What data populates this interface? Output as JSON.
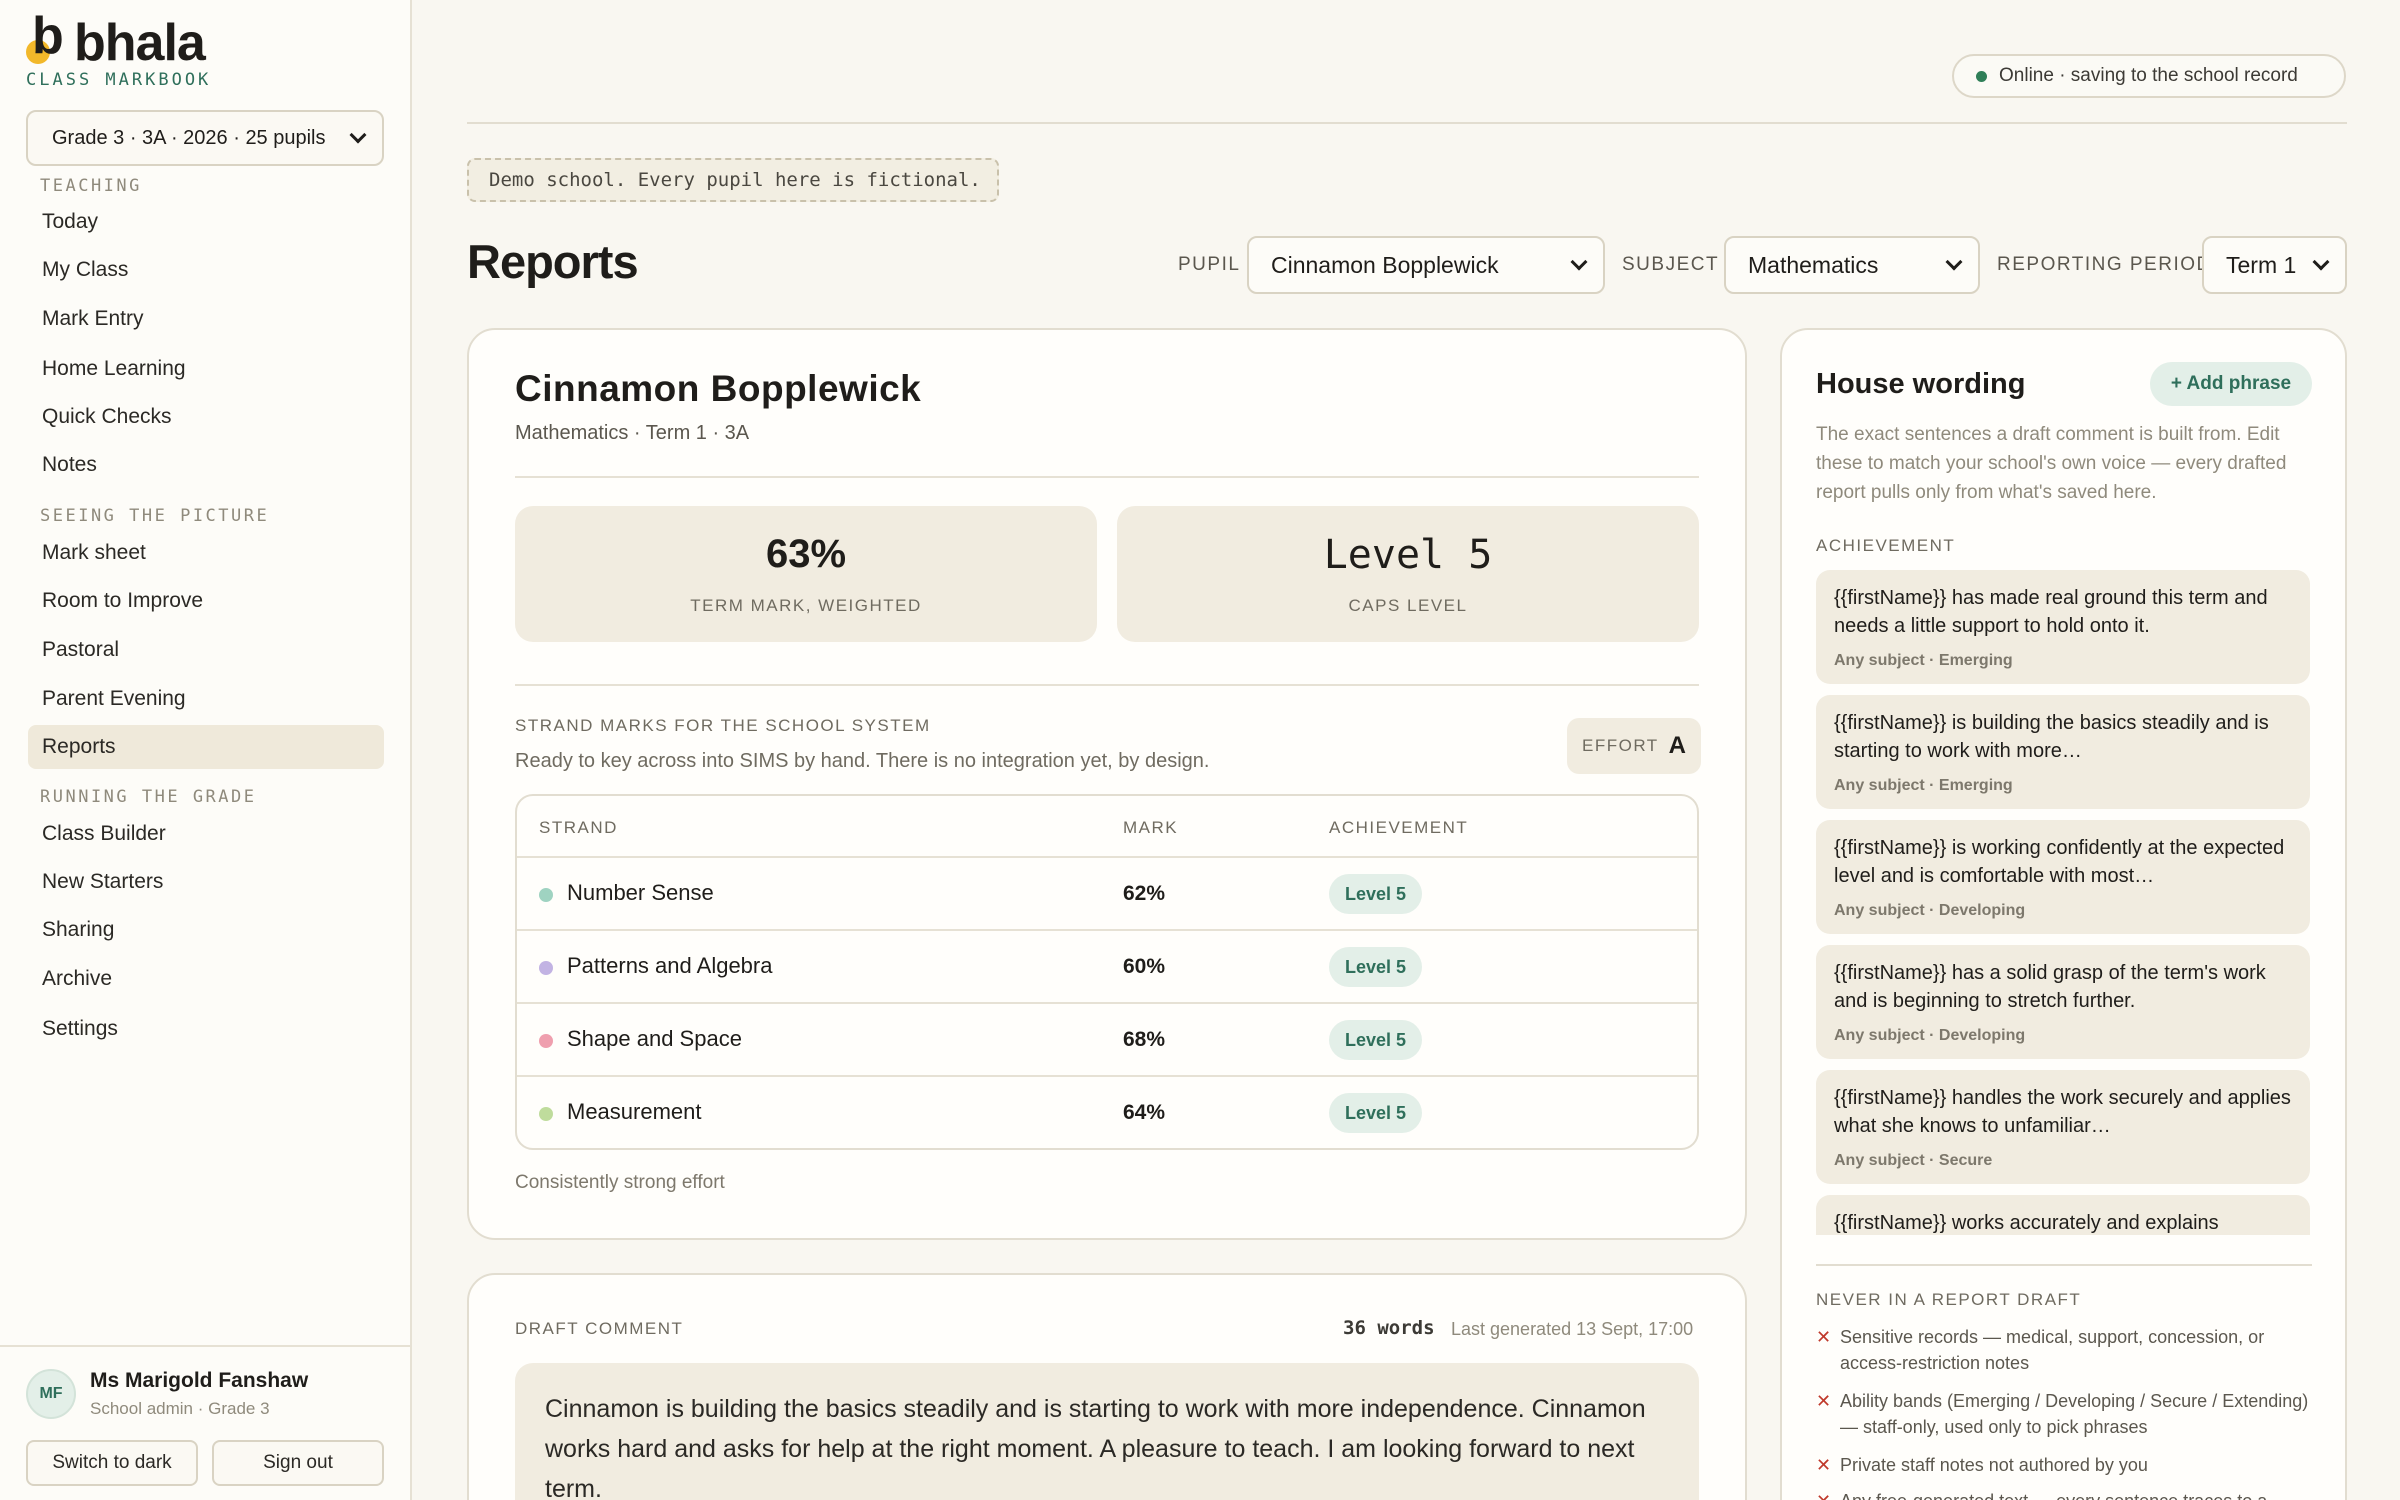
{
  "brand": {
    "logo_letter": "b",
    "name": "bhala",
    "subtitle": "CLASS MARKBOOK"
  },
  "class_selector": {
    "value": "Grade 3 · 3A · 2026 · 25 pupils"
  },
  "nav": {
    "groups": [
      {
        "title": "TEACHING",
        "items": [
          "Today",
          "My Class",
          "Mark Entry",
          "Home Learning",
          "Quick Checks",
          "Notes"
        ]
      },
      {
        "title": "SEEING THE PICTURE",
        "items": [
          "Mark sheet",
          "Room to Improve",
          "Pastoral",
          "Parent Evening",
          "Reports"
        ]
      },
      {
        "title": "RUNNING THE GRADE",
        "items": [
          "Class Builder",
          "New Starters",
          "Sharing",
          "Archive",
          "Settings"
        ]
      }
    ],
    "active": "Reports"
  },
  "user": {
    "initials": "MF",
    "name": "Ms Marigold Fanshaw",
    "role": "School admin · Grade 3",
    "switch_theme": "Switch to dark",
    "sign_out": "Sign out"
  },
  "status": {
    "text": "Online · saving to the school record",
    "color": "#2f7f58"
  },
  "demo_notice": "Demo school. Every pupil here is fictional.",
  "page": {
    "title": "Reports"
  },
  "filters": {
    "pupil": {
      "label": "PUPIL",
      "value": "Cinnamon Bopplewick"
    },
    "subject": {
      "label": "SUBJECT",
      "value": "Mathematics"
    },
    "period": {
      "label": "REPORTING PERIOD",
      "value": "Term 1"
    }
  },
  "report": {
    "pupil_name": "Cinnamon Bopplewick",
    "meta": "Mathematics · Term 1 · 3A",
    "term_mark": {
      "value": "63%",
      "label": "TERM MARK, WEIGHTED"
    },
    "caps_level": {
      "value": "Level 5",
      "label": "CAPS LEVEL"
    },
    "strands_title": "STRAND MARKS FOR THE SCHOOL SYSTEM",
    "strands_subtitle": "Ready to key across into SIMS by hand. There is no integration yet, by design.",
    "effort": {
      "label": "EFFORT",
      "grade": "A"
    },
    "table_headers": {
      "strand": "STRAND",
      "mark": "MARK",
      "achievement": "ACHIEVEMENT"
    },
    "strands": [
      {
        "name": "Number Sense",
        "mark": "62%",
        "level": "Level 5",
        "color": "#9fd3c1"
      },
      {
        "name": "Patterns and Algebra",
        "mark": "60%",
        "level": "Level 5",
        "color": "#c2b3e3"
      },
      {
        "name": "Shape and Space",
        "mark": "68%",
        "level": "Level 5",
        "color": "#ef9fae"
      },
      {
        "name": "Measurement",
        "mark": "64%",
        "level": "Level 5",
        "color": "#bfdc9c"
      }
    ],
    "effort_note": "Consistently strong effort"
  },
  "draft": {
    "label": "DRAFT COMMENT",
    "words": "36 words",
    "generated": "Last generated 13 Sept, 17:00",
    "body": "Cinnamon is building the basics steadily and is starting to work with more independence. Cinnamon works hard and asks for help at the right moment. A pleasure to teach. I am looking forward to next term."
  },
  "house_wording": {
    "title": "House wording",
    "add_label": "+ Add phrase",
    "intro": "The exact sentences a draft comment is built from. Edit these to match your school's own voice — every drafted report pulls only from what's saved here.",
    "section": "ACHIEVEMENT",
    "phrases": [
      {
        "text": "{{firstName}} has made real ground this term and needs a little support to hold onto it.",
        "meta": "Any subject · Emerging"
      },
      {
        "text": "{{firstName}} is building the basics steadily and is starting to work with more…",
        "meta": "Any subject · Emerging"
      },
      {
        "text": "{{firstName}} is working confidently at the expected level and is comfortable with most…",
        "meta": "Any subject · Developing"
      },
      {
        "text": "{{firstName}} has a solid grasp of the term's work and is beginning to stretch further.",
        "meta": "Any subject · Developing"
      },
      {
        "text": "{{firstName}} handles the work securely and applies what she knows to unfamiliar…",
        "meta": "Any subject · Secure"
      },
      {
        "text": "{{firstName}} works accurately and explains",
        "meta": ""
      }
    ],
    "never_title": "NEVER IN A REPORT DRAFT",
    "never_items": [
      "Sensitive records — medical, support, concession, or access-restriction notes",
      "Ability bands (Emerging / Developing / Secure / Extending) — staff-only, used only to pick phrases",
      "Private staff notes not authored by you",
      "Any free-generated text — every sentence traces to a"
    ]
  }
}
